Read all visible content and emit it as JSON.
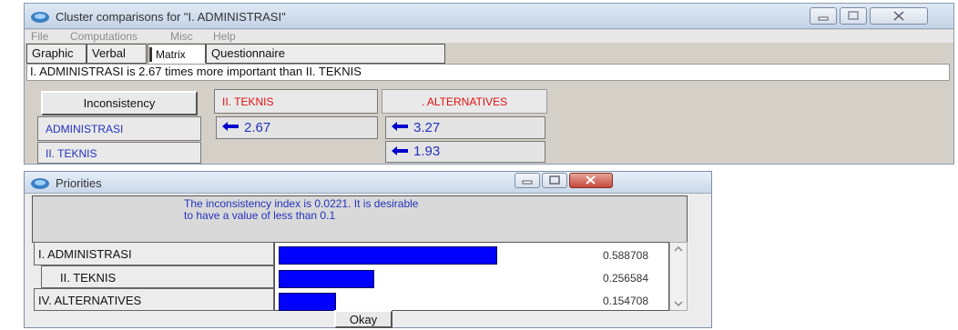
{
  "cluster_window": {
    "title": "Cluster comparisons for \"I. ADMINISTRASI\"",
    "menu": [
      "File",
      "Computations",
      "Misc",
      "Help"
    ],
    "tabs": [
      "Graphic",
      "Verbal",
      "Matrix",
      "Questionnaire"
    ],
    "active_tab": "Matrix",
    "statement": "I. ADMINISTRASI is 2.67 times more important than  II. TEKNIS",
    "inconsistency_button": "Inconsistency",
    "col_headers": [
      "II. TEKNIS",
      ". ALTERNATIVES"
    ],
    "row_headers": [
      "ADMINISTRASI",
      "II. TEKNIS"
    ],
    "values": {
      "admin_teknis": "2.67",
      "admin_alternatives": "3.27",
      "teknis_alternatives": "1.93"
    },
    "colors": {
      "header_red": "#e01010",
      "row_blue": "#2233bb"
    }
  },
  "priorities_window": {
    "title": "Priorities",
    "message": "The inconsistency index is 0.0221.  It is desirable to have a value of less than 0.1",
    "items": [
      {
        "label": "I. ADMINISTRASI",
        "value": 0.588708,
        "value_text": "0.588708"
      },
      {
        "label": "II. TEKNIS",
        "value": 0.256584,
        "value_text": "0.256584"
      },
      {
        "label": "IV. ALTERNATIVES",
        "value": 0.154708,
        "value_text": "0.154708"
      }
    ],
    "okay_button": "Okay",
    "colors": {
      "bar": "#0000ff",
      "message": "#2233bb"
    }
  }
}
